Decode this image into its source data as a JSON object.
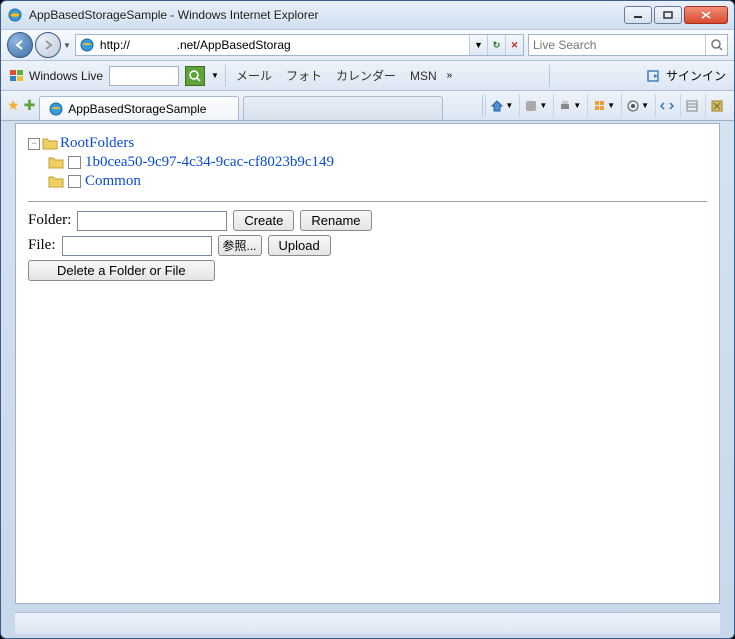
{
  "window": {
    "title": "AppBasedStorageSample - Windows Internet Explorer"
  },
  "addressbar": {
    "url": "http://              .net/AppBasedStorag"
  },
  "search": {
    "placeholder": "Live Search"
  },
  "live_toolbar": {
    "brand": "Windows Live",
    "links": [
      "メール",
      "フォト",
      "カレンダー",
      "MSN"
    ],
    "more": "»",
    "signin": "サインイン"
  },
  "tab": {
    "title": "AppBasedStorageSample"
  },
  "tree": {
    "root": "RootFolders",
    "children": [
      {
        "label": "1b0cea50-9c97-4c34-9cac-cf8023b9c149"
      },
      {
        "label": "Common"
      }
    ]
  },
  "form": {
    "folder_label": "Folder:",
    "file_label": "File:",
    "create": "Create",
    "rename": "Rename",
    "browse": "参照...",
    "upload": "Upload",
    "delete": "Delete a Folder or File"
  }
}
